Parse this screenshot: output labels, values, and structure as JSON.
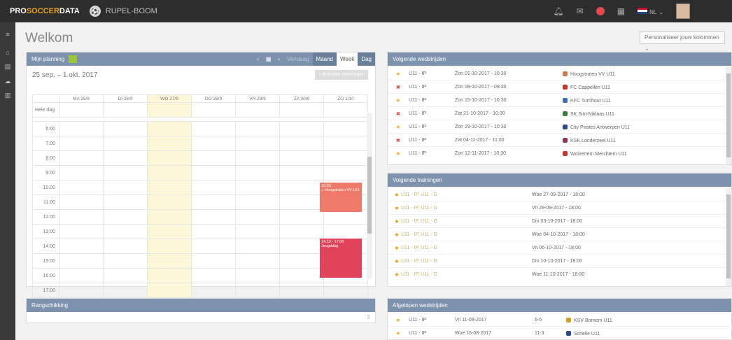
{
  "topbar": {
    "logo_pro": "PRO",
    "logo_soccer": "SOCCER",
    "logo_data": "DATA",
    "club": "RUPEL-BOOM",
    "lang": "NL"
  },
  "page": {
    "title": "Welkom",
    "personalize": "Personaliseer jouw kolommen"
  },
  "planning": {
    "title": "Mijn planning",
    "nav": {
      "prev": "‹",
      "calendar_icon": "calendar-icon",
      "next": "›",
      "today": "Vandaag",
      "month": "Maand",
      "week": "Week",
      "day": "Dag"
    },
    "daterange": "25 sep. – 1 okt. 2017",
    "add_activity": "+ Activiteit toevoegen",
    "days": [
      "MA 25/9",
      "DI 26/9",
      "WO 27/9",
      "DO 28/9",
      "VR 29/9",
      "ZA 30/9",
      "ZO 1/10"
    ],
    "allday": "Hele dag",
    "hours": [
      "6:00",
      "7:00",
      "8:00",
      "9:00",
      "10:00",
      "11:00",
      "12:00",
      "13:00",
      "14:00",
      "15:00",
      "16:00",
      "17:00"
    ],
    "events": [
      {
        "time": "10:30",
        "title": "Hoogstraten VV U11",
        "color": "#f07a6a"
      },
      {
        "time": "14:10 - 17:00",
        "title": "Jeugddag",
        "color": "#e0445a"
      }
    ]
  },
  "ranking": {
    "title": "Rangschikking"
  },
  "upcoming_matches": {
    "title": "Volgende wedstrijden",
    "rows": [
      {
        "status": "star",
        "team": "U11 - IP",
        "date": "Zon 01-10-2017 - 10:30",
        "opponent": "Hoogstraten VV U11",
        "color": "#c87a50"
      },
      {
        "status": "cross",
        "team": "U11 - IP",
        "date": "Zon 08-10-2017 - 09:30",
        "opponent": "FC Cappellen U11",
        "color": "#c0392b"
      },
      {
        "status": "star",
        "team": "U11 - IP",
        "date": "Zon 15-10-2017 - 10:30",
        "opponent": "KFC Turnhout U11",
        "color": "#3b6fb5"
      },
      {
        "status": "cross",
        "team": "U11 - IP",
        "date": "Zat 21-10-2017 - 10:30",
        "opponent": "SK Sint-Niklaas U11",
        "color": "#3e7a3e"
      },
      {
        "status": "star",
        "team": "U11 - IP",
        "date": "Zon 29-10-2017 - 10:30",
        "opponent": "City Pirates Antwerpen U11",
        "color": "#2c4a8a"
      },
      {
        "status": "cross",
        "team": "U11 - IP",
        "date": "Zat 04-11-2017 - 11:00",
        "opponent": "KSK Londerzeel U11",
        "color": "#8a3b5a"
      },
      {
        "status": "star",
        "team": "U11 - IP",
        "date": "Zon 12-11-2017 - 10:30",
        "opponent": "Wolvertem Merchtem U11",
        "color": "#c0392b"
      }
    ]
  },
  "trainings": {
    "title": "Volgende trainingen",
    "rows": [
      {
        "team": "U11 - IP, U11 - G",
        "date": "Woe 27-09-2017 - 18:00"
      },
      {
        "team": "U11 - IP, U11 - G",
        "date": "Vri 29-09-2017 - 18:00"
      },
      {
        "team": "U11 - IP, U11 - G",
        "date": "Din 03-10-2017 - 18:00"
      },
      {
        "team": "U11 - IP, U11 - G",
        "date": "Woe 04-10-2017 - 18:00"
      },
      {
        "team": "U11 - IP, U11 - G",
        "date": "Vri 06-10-2017 - 18:00"
      },
      {
        "team": "U11 - IP, U11 - G",
        "date": "Din 10-10-2017 - 18:00"
      },
      {
        "team": "U11 - IP, U11 - G",
        "date": "Woe 11-10-2017 - 18:00"
      }
    ]
  },
  "past_matches": {
    "title": "Afgelopen wedstrijden",
    "rows": [
      {
        "team": "U11 - IP",
        "date": "Vri 11-08-2017",
        "score": "6-5",
        "opponent": "KSV Bornem U11",
        "color": "#d4a020"
      },
      {
        "team": "U11 - IP",
        "date": "Woe 16-08-2017",
        "score": "11-3",
        "opponent": "Schelle U11",
        "color": "#2c4a8a"
      }
    ]
  }
}
